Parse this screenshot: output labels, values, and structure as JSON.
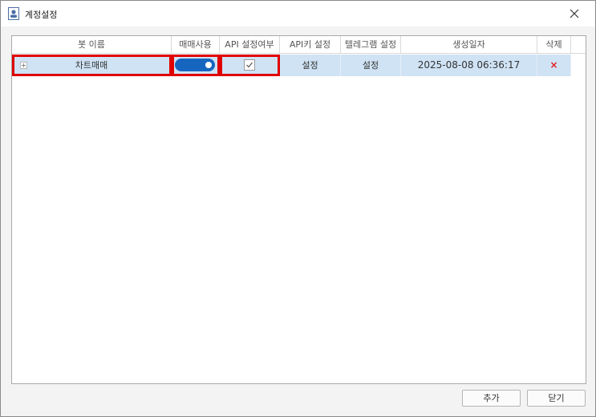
{
  "window": {
    "title": "계정설정"
  },
  "grid": {
    "columns": [
      "봇 이름",
      "매매사용",
      "API 설정여부",
      "API키 설정",
      "텔레그램 설정",
      "생성일자",
      "삭제"
    ],
    "rows": [
      {
        "bot_name": "차트매매",
        "trading_enabled": true,
        "api_configured": true,
        "api_key_action": "설정",
        "telegram_action": "설정",
        "created_at": "2025-08-08 06:36:17",
        "delete_symbol": "×"
      }
    ]
  },
  "buttons": {
    "add": "추가",
    "close": "닫기"
  },
  "colors": {
    "selected_row": "#cfe3f5",
    "toggle_on": "#1666c0",
    "highlight": "#e00000",
    "delete": "#e02020"
  }
}
